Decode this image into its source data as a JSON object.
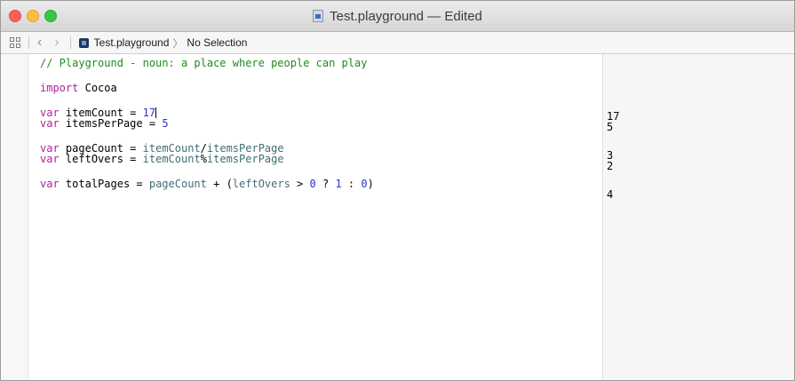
{
  "window": {
    "title": "Test.playground — Edited",
    "traffic_lights": [
      "close",
      "minimize",
      "zoom"
    ]
  },
  "jumpbar": {
    "file": "Test.playground",
    "selection": "No Selection"
  },
  "code": {
    "comment": "// Playground - noun: a place where people can play",
    "import_kw": "import",
    "import_mod": "Cocoa",
    "l1": {
      "kw": "var",
      "name": "itemCount",
      "op": " = ",
      "value": "17"
    },
    "l2": {
      "kw": "var",
      "name": "itemsPerPage",
      "op": " = ",
      "value": "5"
    },
    "l3": {
      "kw": "var",
      "name": "pageCount",
      "op": " = ",
      "ref1": "itemCount",
      "op2": "/",
      "ref2": "itemsPerPage"
    },
    "l4": {
      "kw": "var",
      "name": "leftOvers",
      "op": " = ",
      "ref1": "itemCount",
      "op2": "%",
      "ref2": "itemsPerPage"
    },
    "l5": {
      "kw": "var",
      "name": "totalPages",
      "op": " = ",
      "ref1": "pageCount",
      "op2": " + (",
      "ref2": "leftOvers",
      "op3": " > ",
      "n1": "0",
      "op4": " ? ",
      "n2": "1",
      "op5": " : ",
      "n3": "0",
      "op6": ")"
    }
  },
  "results": [
    "17",
    "5",
    "3",
    "2",
    "4"
  ],
  "colors": {
    "keyword": "#b3219a",
    "number": "#2b31d6",
    "comment": "#1f8b1f",
    "identifier": "#3f6e74"
  }
}
